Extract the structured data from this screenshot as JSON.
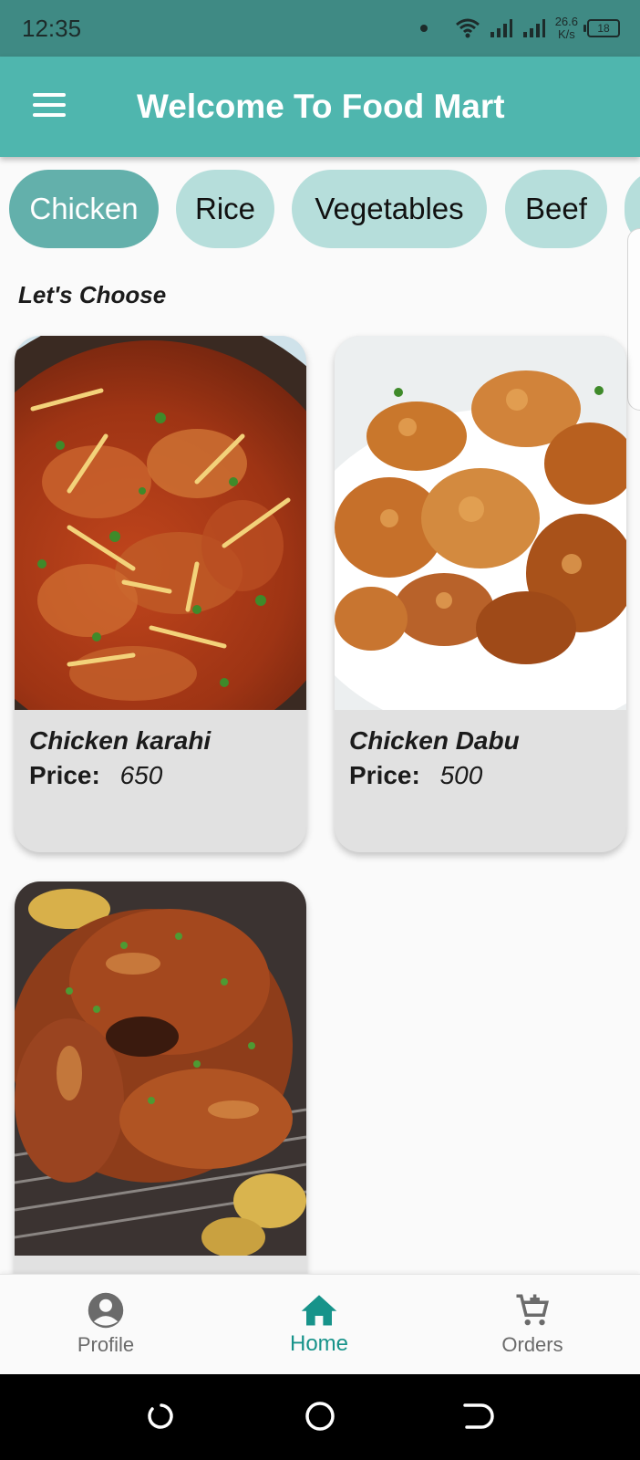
{
  "status_bar": {
    "time": "12:35",
    "speed_value": "26.6",
    "speed_unit": "K/s",
    "battery": "18"
  },
  "app_bar": {
    "title": "Welcome To Food Mart"
  },
  "categories": [
    {
      "label": "Chicken",
      "active": true
    },
    {
      "label": "Rice",
      "active": false
    },
    {
      "label": "Vegetables",
      "active": false
    },
    {
      "label": "Beef",
      "active": false
    }
  ],
  "section_title": "Let's Choose",
  "products": [
    {
      "name": "Chicken karahi",
      "price_label": "Price:",
      "price": "650"
    },
    {
      "name": "Chicken Dabu",
      "price_label": "Price:",
      "price": "500"
    },
    {
      "name": "",
      "price_label": "",
      "price": ""
    }
  ],
  "bottom_nav": [
    {
      "label": "Profile",
      "icon": "account-circle-icon",
      "active": false
    },
    {
      "label": "Home",
      "icon": "home-icon",
      "active": true
    },
    {
      "label": "Orders",
      "icon": "cart-add-icon",
      "active": false
    }
  ],
  "colors": {
    "status_bar": "#3f8a84",
    "app_bar": "#4fb6ae",
    "chip_active": "#63b0ab",
    "chip_inactive": "#b6dedb",
    "nav_active": "#17938a",
    "card_bg": "#e1e1e1"
  }
}
